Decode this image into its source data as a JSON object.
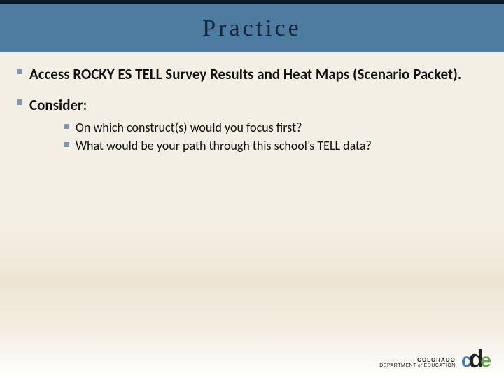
{
  "title": "Practice",
  "bullets": {
    "b1": "Access ROCKY ES TELL Survey Results and Heat Maps (Scenario Packet).",
    "b2": "Consider:",
    "sub1": "On which construct(s) would you focus first?",
    "sub2": "What would be your path through this school’s TELL data?"
  },
  "logo": {
    "state": "COLORADO",
    "dept_prefix": "DEPARTMENT",
    "dept_of": "of",
    "dept_suffix": "EDUCATION",
    "c": "c",
    "d": "d",
    "e": "e"
  }
}
